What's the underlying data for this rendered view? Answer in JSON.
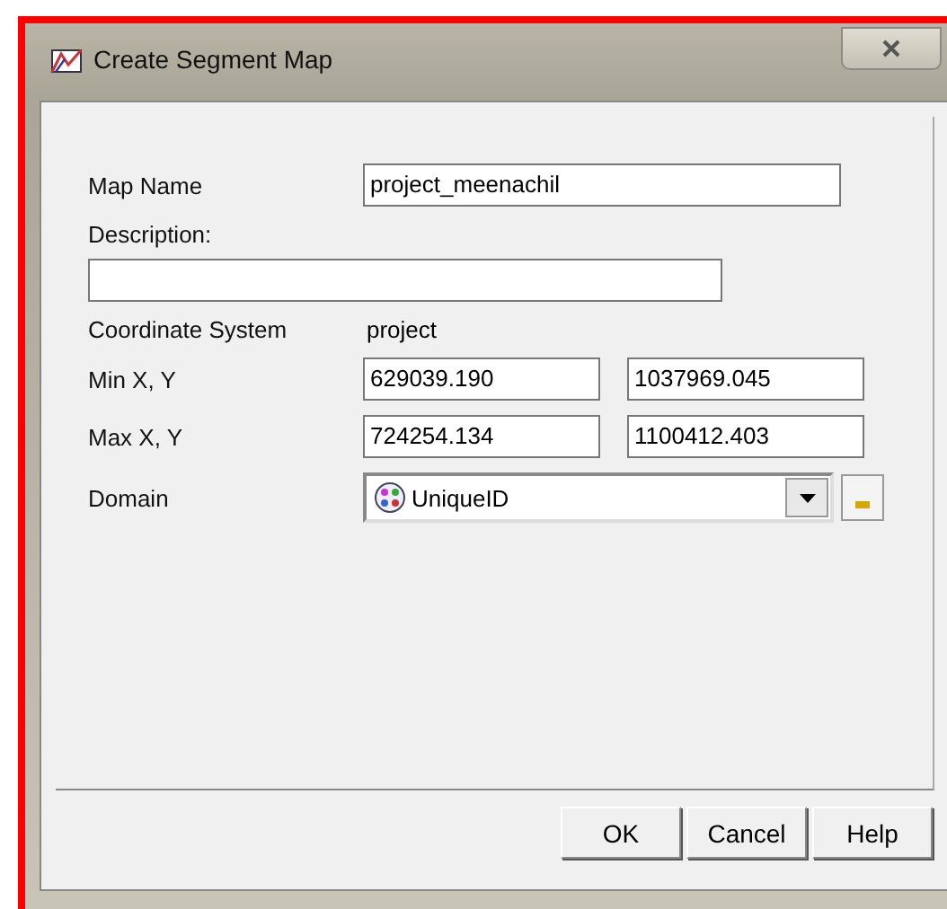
{
  "window": {
    "title": "Create Segment Map"
  },
  "fields": [
    {
      "kind": "text",
      "label": "Map Name",
      "value": "project_meenachil"
    },
    {
      "kind": "wide",
      "label": "Description:"
    },
    {
      "kind": "static",
      "label": "Coordinate System",
      "value": "project"
    },
    {
      "kind": "pair",
      "label": "Min X, Y",
      "values": [
        "629039.190",
        "1037969.045"
      ]
    },
    {
      "kind": "pair",
      "label": "Max X, Y",
      "values": [
        "724254.134",
        "1100412.403"
      ]
    },
    {
      "kind": "combo",
      "label": "Domain",
      "value": "UniqueID"
    }
  ],
  "buttons": [
    "OK",
    "Cancel",
    "Help"
  ]
}
